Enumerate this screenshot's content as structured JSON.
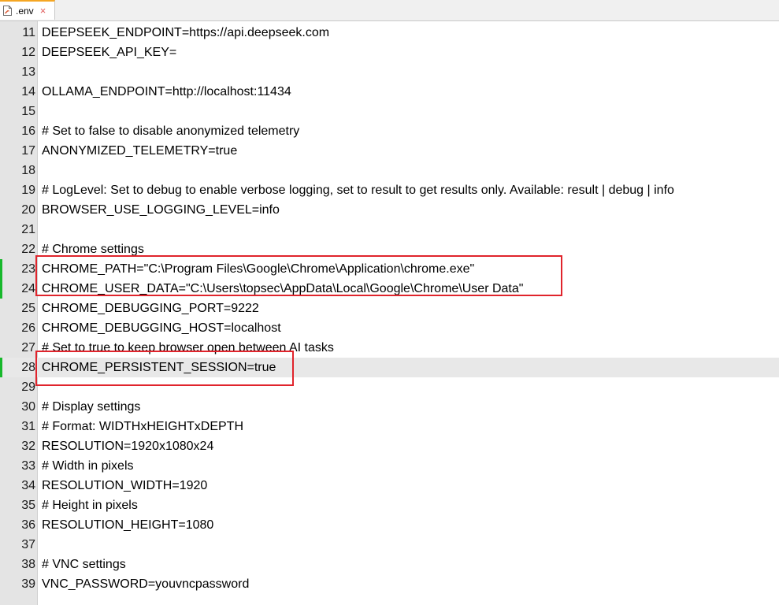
{
  "tab": {
    "title": ".env",
    "close_glyph": "×",
    "icon": "file-icon"
  },
  "lines": [
    {
      "n": "11",
      "text": "DEEPSEEK_ENDPOINT=https://api.deepseek.com",
      "changed": false
    },
    {
      "n": "12",
      "text": "DEEPSEEK_API_KEY=",
      "changed": false
    },
    {
      "n": "13",
      "text": "",
      "changed": false
    },
    {
      "n": "14",
      "text": "OLLAMA_ENDPOINT=http://localhost:11434",
      "changed": false
    },
    {
      "n": "15",
      "text": "",
      "changed": false
    },
    {
      "n": "16",
      "text": "# Set to false to disable anonymized telemetry",
      "changed": false
    },
    {
      "n": "17",
      "text": "ANONYMIZED_TELEMETRY=true",
      "changed": false
    },
    {
      "n": "18",
      "text": "",
      "changed": false
    },
    {
      "n": "19",
      "text": "# LogLevel: Set to debug to enable verbose logging, set to result to get results only. Available: result | debug | info",
      "changed": false
    },
    {
      "n": "20",
      "text": "BROWSER_USE_LOGGING_LEVEL=info",
      "changed": false
    },
    {
      "n": "21",
      "text": "",
      "changed": false
    },
    {
      "n": "22",
      "text": "# Chrome settings",
      "changed": false
    },
    {
      "n": "23",
      "text": "CHROME_PATH=\"C:\\Program Files\\Google\\Chrome\\Application\\chrome.exe\"",
      "changed": true
    },
    {
      "n": "24",
      "text": "CHROME_USER_DATA=\"C:\\Users\\topsec\\AppData\\Local\\Google\\Chrome\\User Data\"",
      "changed": true
    },
    {
      "n": "25",
      "text": "CHROME_DEBUGGING_PORT=9222",
      "changed": false
    },
    {
      "n": "26",
      "text": "CHROME_DEBUGGING_HOST=localhost",
      "changed": false
    },
    {
      "n": "27",
      "text": "# Set to true to keep browser open between AI tasks",
      "changed": false
    },
    {
      "n": "28",
      "text": "CHROME_PERSISTENT_SESSION=true",
      "changed": true,
      "current": true
    },
    {
      "n": "29",
      "text": "",
      "changed": false
    },
    {
      "n": "30",
      "text": "# Display settings",
      "changed": false
    },
    {
      "n": "31",
      "text": "# Format: WIDTHxHEIGHTxDEPTH",
      "changed": false
    },
    {
      "n": "32",
      "text": "RESOLUTION=1920x1080x24",
      "changed": false
    },
    {
      "n": "33",
      "text": "# Width in pixels",
      "changed": false
    },
    {
      "n": "34",
      "text": "RESOLUTION_WIDTH=1920",
      "changed": false
    },
    {
      "n": "35",
      "text": "# Height in pixels",
      "changed": false
    },
    {
      "n": "36",
      "text": "RESOLUTION_HEIGHT=1080",
      "changed": false
    },
    {
      "n": "37",
      "text": "",
      "changed": false
    },
    {
      "n": "38",
      "text": "# VNC settings",
      "changed": false
    },
    {
      "n": "39",
      "text": "VNC_PASSWORD=youvncpassword",
      "changed": false
    }
  ],
  "colors": {
    "change_marker": "#17b82b",
    "annotation": "#e0242c",
    "tab_accent": "#f5a623"
  }
}
